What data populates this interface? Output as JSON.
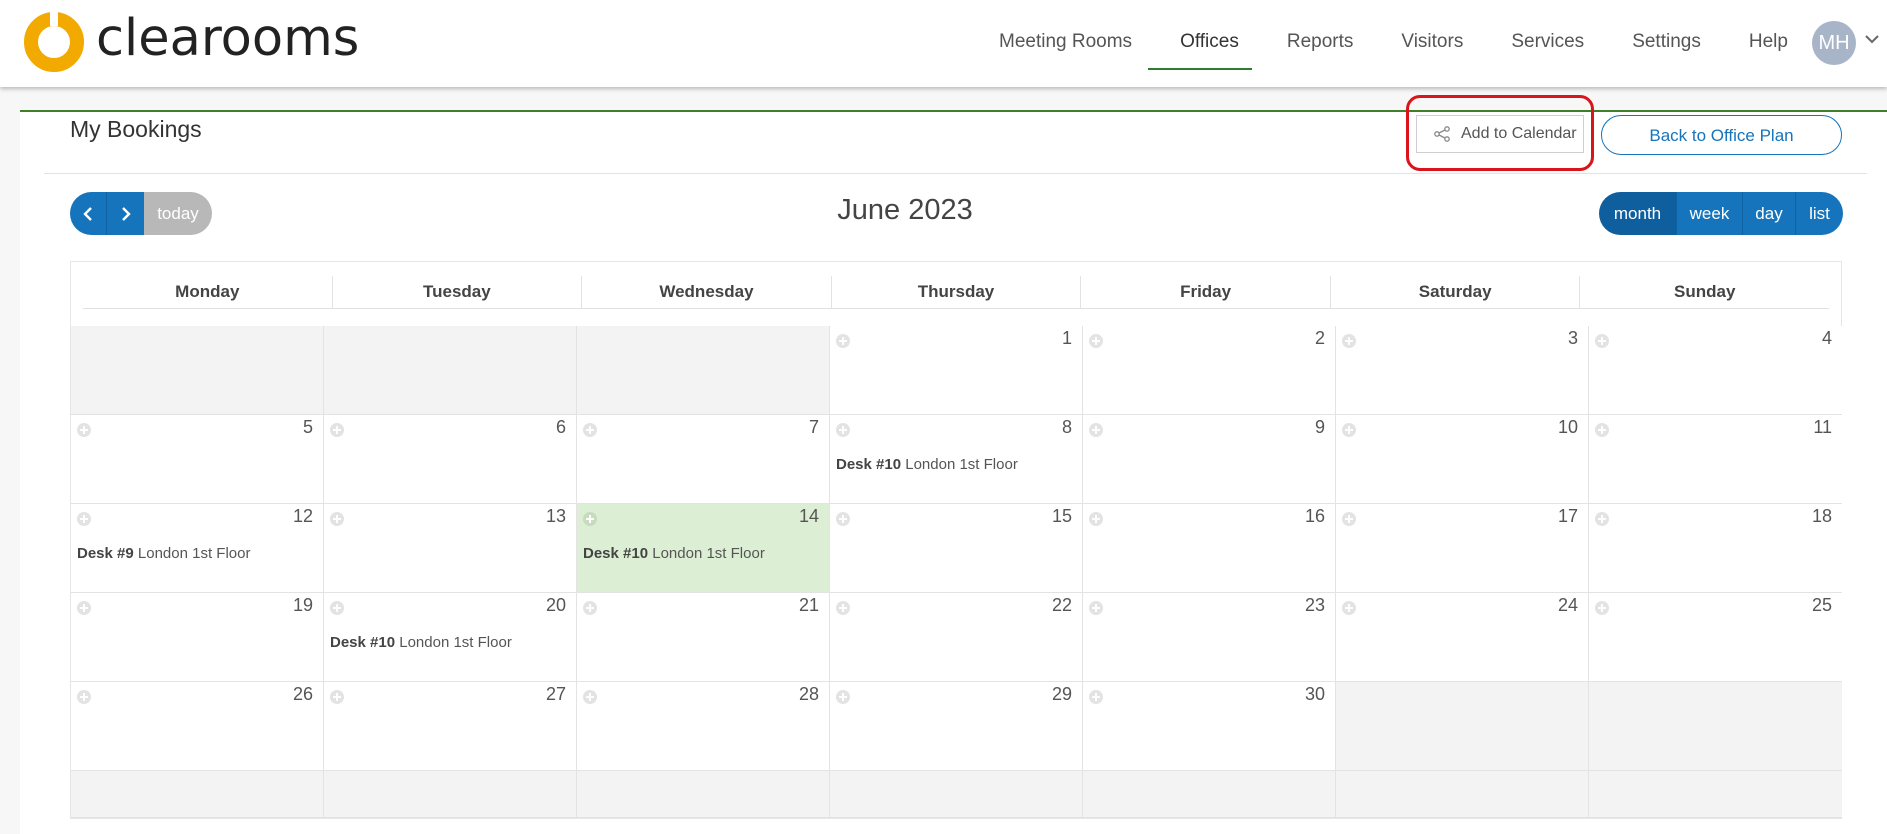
{
  "brand": {
    "name": "clearooms",
    "color": "#f2a900"
  },
  "nav": {
    "items": [
      "Meeting Rooms",
      "Offices",
      "Reports",
      "Visitors",
      "Services",
      "Settings",
      "Help"
    ],
    "active": "Offices"
  },
  "user": {
    "initials": "MH"
  },
  "page": {
    "title": "My Bookings"
  },
  "actions": {
    "add_to_calendar": "Add to Calendar",
    "back_to_office_plan": "Back to Office Plan"
  },
  "toolbar": {
    "today": "today",
    "title": "June 2023",
    "views": [
      "month",
      "week",
      "day",
      "list"
    ],
    "selected_view": "month"
  },
  "calendar": {
    "weekdays": [
      "Monday",
      "Tuesday",
      "Wednesday",
      "Thursday",
      "Friday",
      "Saturday",
      "Sunday"
    ],
    "weeks": [
      [
        "",
        "",
        "",
        "1",
        "2",
        "3",
        "4"
      ],
      [
        "5",
        "6",
        "7",
        "8",
        "9",
        "10",
        "11"
      ],
      [
        "12",
        "13",
        "14",
        "15",
        "16",
        "17",
        "18"
      ],
      [
        "19",
        "20",
        "21",
        "22",
        "23",
        "24",
        "25"
      ],
      [
        "26",
        "27",
        "28",
        "29",
        "30",
        "",
        ""
      ]
    ],
    "today": "14",
    "events": [
      {
        "day": "8",
        "desk": "Desk #10",
        "location": "London 1st Floor"
      },
      {
        "day": "12",
        "desk": "Desk #9",
        "location": "London 1st Floor"
      },
      {
        "day": "14",
        "desk": "Desk #10",
        "location": "London 1st Floor"
      },
      {
        "day": "20",
        "desk": "Desk #10",
        "location": "London 1st Floor"
      }
    ]
  },
  "colors": {
    "primary": "#1574bb",
    "highlight": "#d9141b",
    "today_bg": "#dcefd4",
    "active_nav": "#2f7d32"
  }
}
